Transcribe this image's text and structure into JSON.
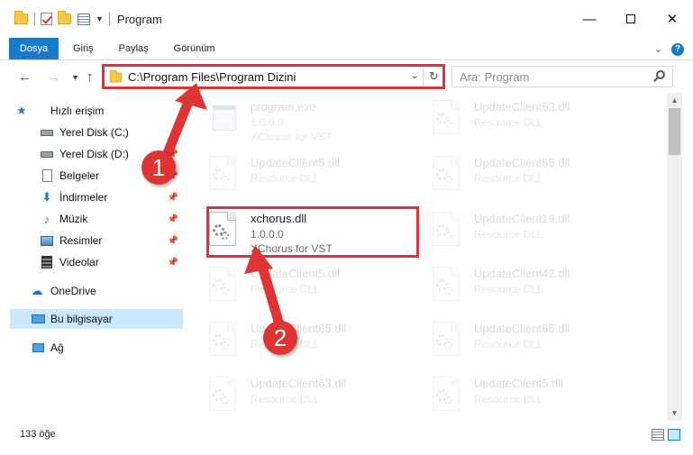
{
  "window": {
    "title": "Program"
  },
  "ribbon": {
    "file_tab": "Dosya",
    "tabs": [
      "Giriş",
      "Paylaş",
      "Görünüm"
    ]
  },
  "address": {
    "path": "C:\\Program Files\\Program Dizini"
  },
  "search": {
    "placeholder": "Ara: Program"
  },
  "sidebar": {
    "quick_access": "Hızlı erişim",
    "items": [
      {
        "label": "Yerel Disk (C:)",
        "icon": "drive-icon",
        "pinned": false
      },
      {
        "label": "Yerel Disk (D:)",
        "icon": "drive-icon",
        "pinned": true
      },
      {
        "label": "Belgeler",
        "icon": "documents-icon",
        "pinned": true
      },
      {
        "label": "İndirmeler",
        "icon": "download-icon",
        "pinned": true
      },
      {
        "label": "Müzik",
        "icon": "music-icon",
        "pinned": true
      },
      {
        "label": "Resimler",
        "icon": "pictures-icon",
        "pinned": true
      },
      {
        "label": "Videolar",
        "icon": "videos-icon",
        "pinned": true
      }
    ],
    "onedrive": "OneDrive",
    "this_pc": "Bu bilgisayar",
    "network": "Ağ"
  },
  "files": [
    {
      "name": "program.exe",
      "line1": "1.0.0.0",
      "line2": "XChorus for VST",
      "icon": "exe-icon",
      "faded": true
    },
    {
      "name": "UpdateClient63.dll",
      "line1": "Resource DLL",
      "line2": "",
      "icon": "dll-icon",
      "faded": true
    },
    {
      "name": "UpdateClient5.dll",
      "line1": "Resource DLL",
      "line2": "",
      "icon": "dll-icon",
      "faded": true
    },
    {
      "name": "UpdateClient65.dll",
      "line1": "Resource DLL",
      "line2": "",
      "icon": "dll-icon",
      "faded": true
    },
    {
      "name": "xchorus.dll",
      "line1": "1.0.0.0",
      "line2": "XChorus for VST",
      "icon": "dll-icon",
      "faded": false
    },
    {
      "name": "UpdateClient19.dll",
      "line1": "Resource DLL",
      "line2": "",
      "icon": "dll-icon",
      "faded": true
    },
    {
      "name": "UpdateClient5.dll",
      "line1": "Resource DLL",
      "line2": "",
      "icon": "dll-icon",
      "faded": true
    },
    {
      "name": "UpdateClient42.dll",
      "line1": "Resource DLL",
      "line2": "",
      "icon": "dll-icon",
      "faded": true
    },
    {
      "name": "UpdateClient65.dll",
      "line1": "Resource DLL",
      "line2": "",
      "icon": "dll-icon",
      "faded": true
    },
    {
      "name": "UpdateClient65.dll",
      "line1": "Resource DLL",
      "line2": "",
      "icon": "dll-icon",
      "faded": true
    },
    {
      "name": "UpdateClient63.dll",
      "line1": "Resource DLL",
      "line2": "",
      "icon": "dll-icon",
      "faded": true
    },
    {
      "name": "UpdateClient5.dll",
      "line1": "Resource DLL",
      "line2": "",
      "icon": "dll-icon",
      "faded": true
    }
  ],
  "status": {
    "count": "133 öğe"
  },
  "annotations": {
    "callout1": "1",
    "callout2": "2",
    "color": "#e03434"
  },
  "colors": {
    "accent": "#1979ca",
    "selection": "#cce8ff"
  }
}
